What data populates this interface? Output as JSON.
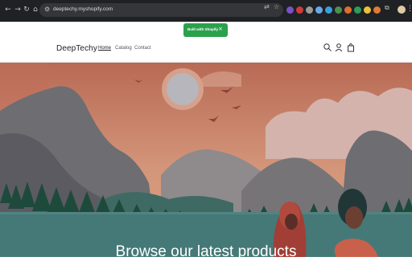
{
  "browser": {
    "url": "deeptechy.myshopify.com",
    "icons": [
      "back-arrow-icon",
      "forward-arrow-icon",
      "reload-icon",
      "home-icon",
      "site-settings-icon",
      "translate-icon",
      "bookmark-star-icon",
      "extensions-icon",
      "profile-avatar",
      "more-menu-icon"
    ]
  },
  "toast": {
    "label": "Built with Shopify",
    "close": "×",
    "color": "#2ba14c"
  },
  "store": {
    "logo": "DeepTechy",
    "nav": [
      "Home",
      "Catalog",
      "Contact"
    ],
    "icons": [
      "search-icon",
      "account-icon",
      "cart-icon"
    ]
  },
  "hero": {
    "title": "Browse our latest products"
  }
}
